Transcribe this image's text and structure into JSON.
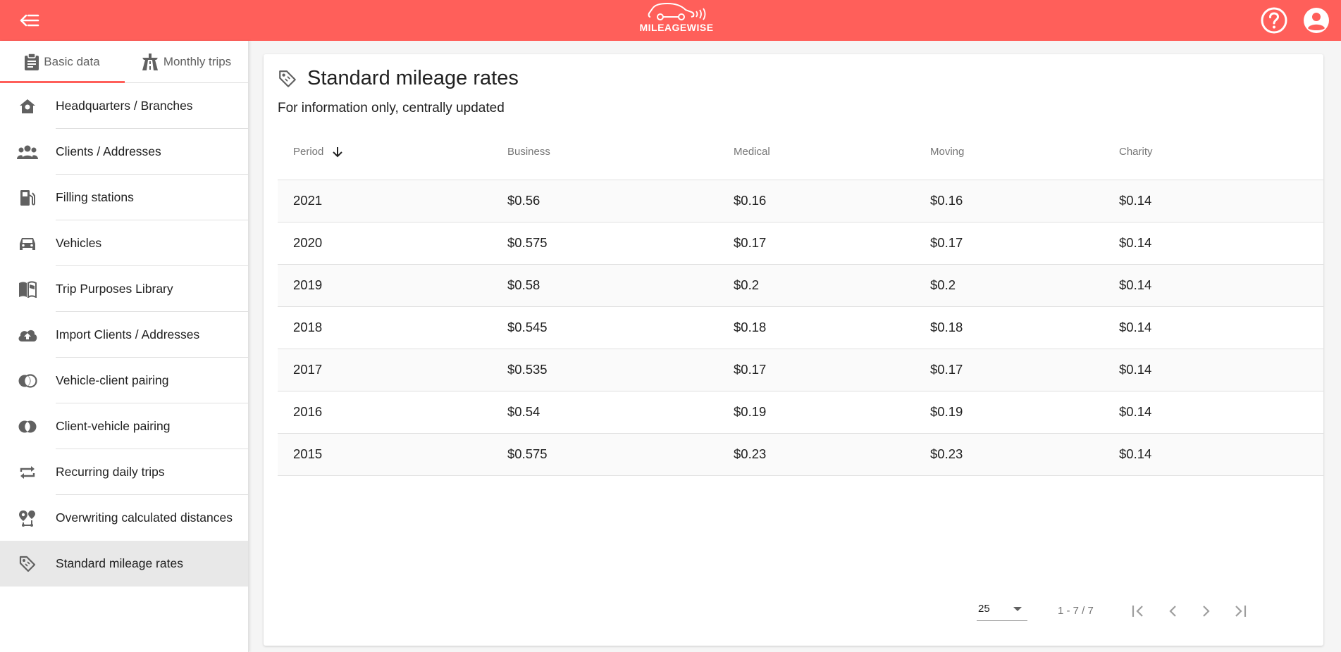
{
  "header": {
    "logo_text": "MILEAGEWISE",
    "brand_color": "#ff5f5a",
    "icons": [
      "back-menu-icon",
      "help-icon",
      "account-icon"
    ]
  },
  "sidebar": {
    "tabs": [
      {
        "label": "Basic data",
        "icon": "clipboard-icon",
        "active": true
      },
      {
        "label": "Monthly trips",
        "icon": "road-icon",
        "active": false
      }
    ],
    "items": [
      {
        "label": "Headquarters / Branches",
        "icon": "home-pin-icon"
      },
      {
        "label": "Clients / Addresses",
        "icon": "people-icon"
      },
      {
        "label": "Filling stations",
        "icon": "fuel-icon"
      },
      {
        "label": "Vehicles",
        "icon": "car-icon"
      },
      {
        "label": "Trip Purposes Library",
        "icon": "book-icon"
      },
      {
        "label": "Import Clients / Addresses",
        "icon": "cloud-upload-icon"
      },
      {
        "label": "Vehicle-client pairing",
        "icon": "pairing-icon"
      },
      {
        "label": "Client-vehicle pairing",
        "icon": "pairing-icon"
      },
      {
        "label": "Recurring daily trips",
        "icon": "repeat-icon"
      },
      {
        "label": "Overwriting calculated distances",
        "icon": "route-icon"
      },
      {
        "label": "Standard mileage rates",
        "icon": "tag-icon",
        "selected": true
      }
    ]
  },
  "main": {
    "title": "Standard mileage rates",
    "subtitle": "For information only, centrally updated",
    "columns": [
      "Period",
      "Business",
      "Medical",
      "Moving",
      "Charity"
    ],
    "sort_column": "Period",
    "rows": [
      [
        "2021",
        "$0.56",
        "$0.16",
        "$0.16",
        "$0.14"
      ],
      [
        "2020",
        "$0.575",
        "$0.17",
        "$0.17",
        "$0.14"
      ],
      [
        "2019",
        "$0.58",
        "$0.2",
        "$0.2",
        "$0.14"
      ],
      [
        "2018",
        "$0.545",
        "$0.18",
        "$0.18",
        "$0.14"
      ],
      [
        "2017",
        "$0.535",
        "$0.17",
        "$0.17",
        "$0.14"
      ],
      [
        "2016",
        "$0.54",
        "$0.19",
        "$0.19",
        "$0.14"
      ],
      [
        "2015",
        "$0.575",
        "$0.23",
        "$0.23",
        "$0.14"
      ]
    ],
    "paginator": {
      "page_size": "25",
      "range": "1 - 7 / 7"
    }
  }
}
